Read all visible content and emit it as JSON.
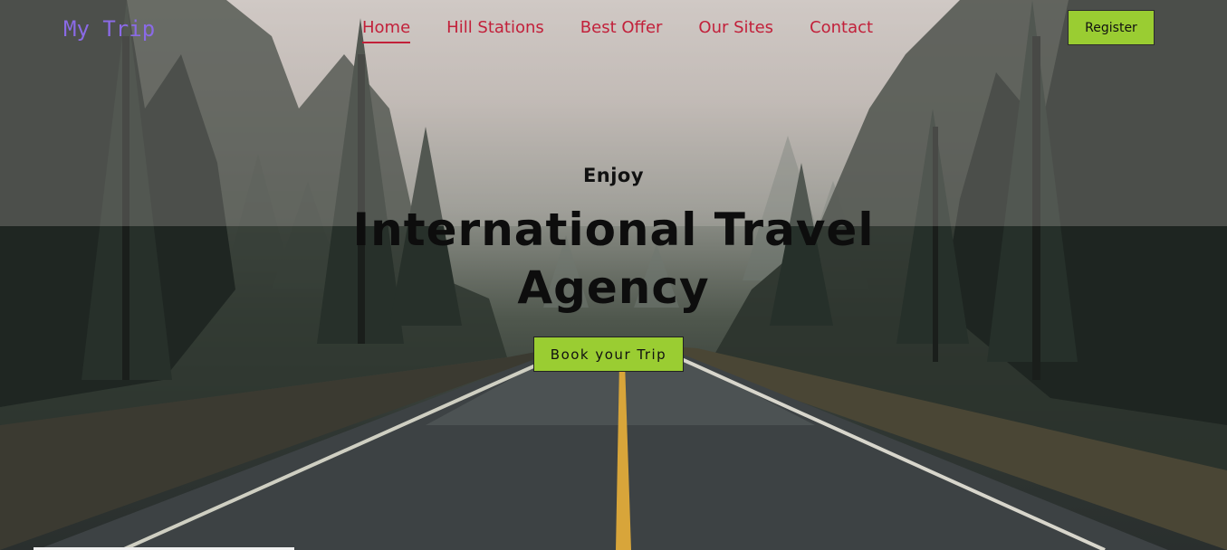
{
  "brand": {
    "logo_text": "My Trip"
  },
  "nav": {
    "items": [
      {
        "label": "Home",
        "active": true
      },
      {
        "label": "Hill Stations",
        "active": false
      },
      {
        "label": "Best Offer",
        "active": false
      },
      {
        "label": "Our Sites",
        "active": false
      },
      {
        "label": "Contact",
        "active": false
      }
    ]
  },
  "header": {
    "register_label": "Register"
  },
  "hero": {
    "eyebrow": "Enjoy",
    "title_line1": "International Travel",
    "title_line2": "Agency",
    "cta_label": "Book your Trip"
  },
  "colors": {
    "accent_green": "#9acd32",
    "nav_red": "#c2203a",
    "logo_purple": "#8a6ae6"
  }
}
